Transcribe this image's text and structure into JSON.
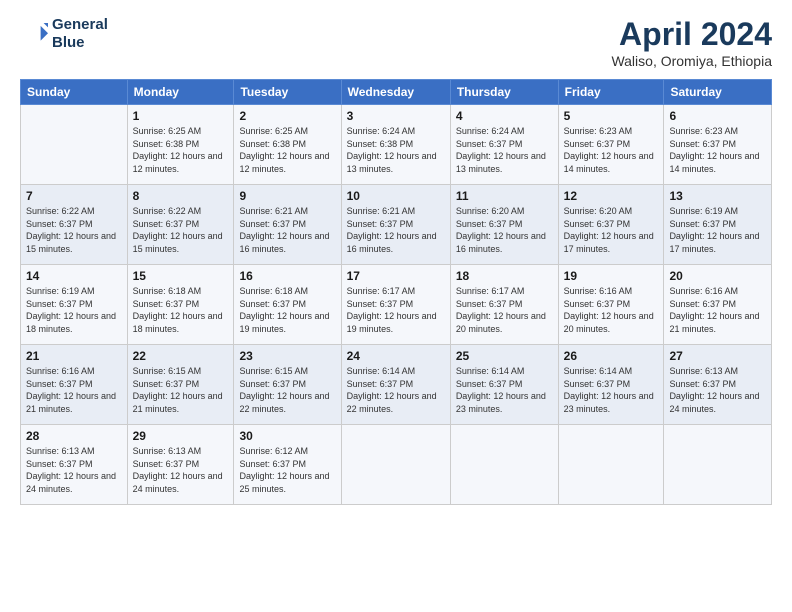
{
  "header": {
    "logo_line1": "General",
    "logo_line2": "Blue",
    "month_title": "April 2024",
    "location": "Waliso, Oromiya, Ethiopia"
  },
  "weekdays": [
    "Sunday",
    "Monday",
    "Tuesday",
    "Wednesday",
    "Thursday",
    "Friday",
    "Saturday"
  ],
  "weeks": [
    [
      {
        "day": "",
        "sunrise": "",
        "sunset": "",
        "daylight": ""
      },
      {
        "day": "1",
        "sunrise": "Sunrise: 6:25 AM",
        "sunset": "Sunset: 6:38 PM",
        "daylight": "Daylight: 12 hours and 12 minutes."
      },
      {
        "day": "2",
        "sunrise": "Sunrise: 6:25 AM",
        "sunset": "Sunset: 6:38 PM",
        "daylight": "Daylight: 12 hours and 12 minutes."
      },
      {
        "day": "3",
        "sunrise": "Sunrise: 6:24 AM",
        "sunset": "Sunset: 6:38 PM",
        "daylight": "Daylight: 12 hours and 13 minutes."
      },
      {
        "day": "4",
        "sunrise": "Sunrise: 6:24 AM",
        "sunset": "Sunset: 6:37 PM",
        "daylight": "Daylight: 12 hours and 13 minutes."
      },
      {
        "day": "5",
        "sunrise": "Sunrise: 6:23 AM",
        "sunset": "Sunset: 6:37 PM",
        "daylight": "Daylight: 12 hours and 14 minutes."
      },
      {
        "day": "6",
        "sunrise": "Sunrise: 6:23 AM",
        "sunset": "Sunset: 6:37 PM",
        "daylight": "Daylight: 12 hours and 14 minutes."
      }
    ],
    [
      {
        "day": "7",
        "sunrise": "Sunrise: 6:22 AM",
        "sunset": "Sunset: 6:37 PM",
        "daylight": "Daylight: 12 hours and 15 minutes."
      },
      {
        "day": "8",
        "sunrise": "Sunrise: 6:22 AM",
        "sunset": "Sunset: 6:37 PM",
        "daylight": "Daylight: 12 hours and 15 minutes."
      },
      {
        "day": "9",
        "sunrise": "Sunrise: 6:21 AM",
        "sunset": "Sunset: 6:37 PM",
        "daylight": "Daylight: 12 hours and 16 minutes."
      },
      {
        "day": "10",
        "sunrise": "Sunrise: 6:21 AM",
        "sunset": "Sunset: 6:37 PM",
        "daylight": "Daylight: 12 hours and 16 minutes."
      },
      {
        "day": "11",
        "sunrise": "Sunrise: 6:20 AM",
        "sunset": "Sunset: 6:37 PM",
        "daylight": "Daylight: 12 hours and 16 minutes."
      },
      {
        "day": "12",
        "sunrise": "Sunrise: 6:20 AM",
        "sunset": "Sunset: 6:37 PM",
        "daylight": "Daylight: 12 hours and 17 minutes."
      },
      {
        "day": "13",
        "sunrise": "Sunrise: 6:19 AM",
        "sunset": "Sunset: 6:37 PM",
        "daylight": "Daylight: 12 hours and 17 minutes."
      }
    ],
    [
      {
        "day": "14",
        "sunrise": "Sunrise: 6:19 AM",
        "sunset": "Sunset: 6:37 PM",
        "daylight": "Daylight: 12 hours and 18 minutes."
      },
      {
        "day": "15",
        "sunrise": "Sunrise: 6:18 AM",
        "sunset": "Sunset: 6:37 PM",
        "daylight": "Daylight: 12 hours and 18 minutes."
      },
      {
        "day": "16",
        "sunrise": "Sunrise: 6:18 AM",
        "sunset": "Sunset: 6:37 PM",
        "daylight": "Daylight: 12 hours and 19 minutes."
      },
      {
        "day": "17",
        "sunrise": "Sunrise: 6:17 AM",
        "sunset": "Sunset: 6:37 PM",
        "daylight": "Daylight: 12 hours and 19 minutes."
      },
      {
        "day": "18",
        "sunrise": "Sunrise: 6:17 AM",
        "sunset": "Sunset: 6:37 PM",
        "daylight": "Daylight: 12 hours and 20 minutes."
      },
      {
        "day": "19",
        "sunrise": "Sunrise: 6:16 AM",
        "sunset": "Sunset: 6:37 PM",
        "daylight": "Daylight: 12 hours and 20 minutes."
      },
      {
        "day": "20",
        "sunrise": "Sunrise: 6:16 AM",
        "sunset": "Sunset: 6:37 PM",
        "daylight": "Daylight: 12 hours and 21 minutes."
      }
    ],
    [
      {
        "day": "21",
        "sunrise": "Sunrise: 6:16 AM",
        "sunset": "Sunset: 6:37 PM",
        "daylight": "Daylight: 12 hours and 21 minutes."
      },
      {
        "day": "22",
        "sunrise": "Sunrise: 6:15 AM",
        "sunset": "Sunset: 6:37 PM",
        "daylight": "Daylight: 12 hours and 21 minutes."
      },
      {
        "day": "23",
        "sunrise": "Sunrise: 6:15 AM",
        "sunset": "Sunset: 6:37 PM",
        "daylight": "Daylight: 12 hours and 22 minutes."
      },
      {
        "day": "24",
        "sunrise": "Sunrise: 6:14 AM",
        "sunset": "Sunset: 6:37 PM",
        "daylight": "Daylight: 12 hours and 22 minutes."
      },
      {
        "day": "25",
        "sunrise": "Sunrise: 6:14 AM",
        "sunset": "Sunset: 6:37 PM",
        "daylight": "Daylight: 12 hours and 23 minutes."
      },
      {
        "day": "26",
        "sunrise": "Sunrise: 6:14 AM",
        "sunset": "Sunset: 6:37 PM",
        "daylight": "Daylight: 12 hours and 23 minutes."
      },
      {
        "day": "27",
        "sunrise": "Sunrise: 6:13 AM",
        "sunset": "Sunset: 6:37 PM",
        "daylight": "Daylight: 12 hours and 24 minutes."
      }
    ],
    [
      {
        "day": "28",
        "sunrise": "Sunrise: 6:13 AM",
        "sunset": "Sunset: 6:37 PM",
        "daylight": "Daylight: 12 hours and 24 minutes."
      },
      {
        "day": "29",
        "sunrise": "Sunrise: 6:13 AM",
        "sunset": "Sunset: 6:37 PM",
        "daylight": "Daylight: 12 hours and 24 minutes."
      },
      {
        "day": "30",
        "sunrise": "Sunrise: 6:12 AM",
        "sunset": "Sunset: 6:37 PM",
        "daylight": "Daylight: 12 hours and 25 minutes."
      },
      {
        "day": "",
        "sunrise": "",
        "sunset": "",
        "daylight": ""
      },
      {
        "day": "",
        "sunrise": "",
        "sunset": "",
        "daylight": ""
      },
      {
        "day": "",
        "sunrise": "",
        "sunset": "",
        "daylight": ""
      },
      {
        "day": "",
        "sunrise": "",
        "sunset": "",
        "daylight": ""
      }
    ]
  ]
}
